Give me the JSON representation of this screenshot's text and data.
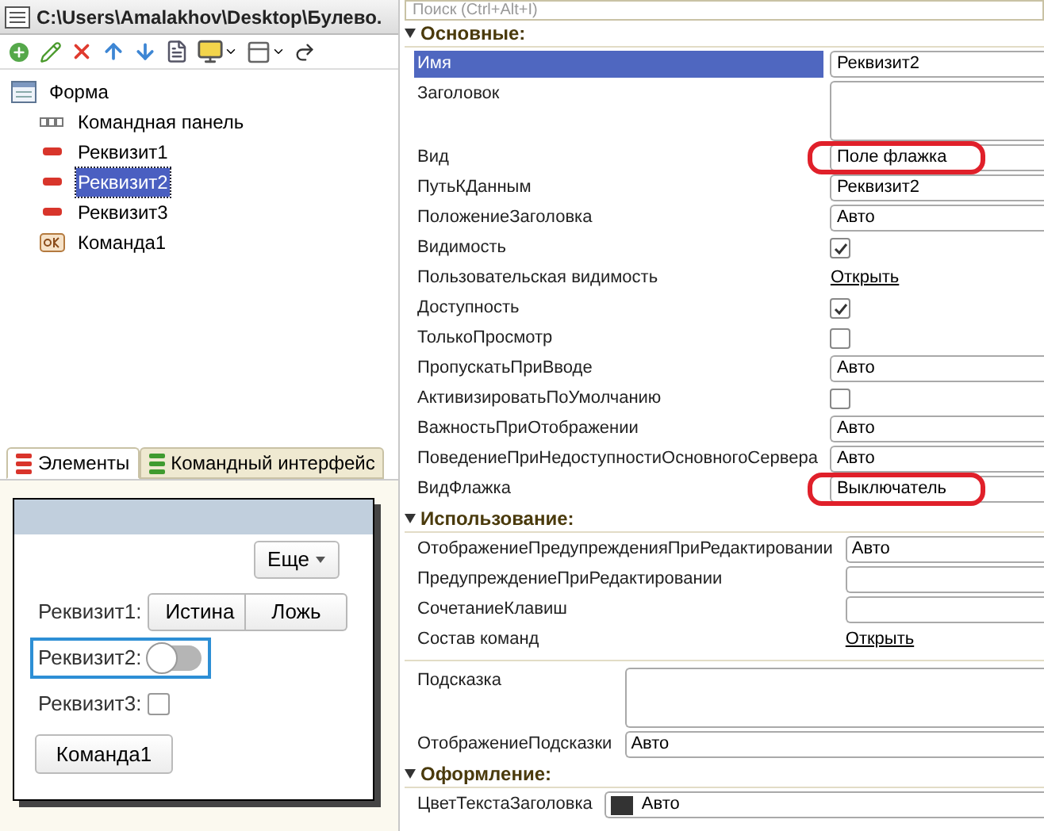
{
  "window": {
    "title": "C:\\Users\\Amalakhov\\Desktop\\Булево."
  },
  "tree": [
    {
      "label": "Форма",
      "kind": "form",
      "selected": false,
      "children": [
        {
          "label": "Командная панель",
          "kind": "command_bar",
          "selected": false
        },
        {
          "label": "Реквизит1",
          "kind": "attribute",
          "selected": false
        },
        {
          "label": "Реквизит2",
          "kind": "attribute",
          "selected": true
        },
        {
          "label": "Реквизит3",
          "kind": "attribute",
          "selected": false
        },
        {
          "label": "Команда1",
          "kind": "command",
          "selected": false
        }
      ]
    }
  ],
  "left_tabs": [
    {
      "label": "Элементы",
      "selected": true,
      "color": "#d9342b"
    },
    {
      "label": "Командный интерфейс",
      "selected": false,
      "color": "#3f9b2f"
    }
  ],
  "preview": {
    "more_button": "Еще",
    "fields": [
      {
        "kind": "toggle_buttons",
        "label": "Реквизит1:",
        "options": [
          "Истина",
          "Ложь"
        ],
        "focused": false
      },
      {
        "kind": "switch",
        "label": "Реквизит2:",
        "on": false,
        "focused": true
      },
      {
        "kind": "checkbox",
        "label": "Реквизит3:",
        "checked": false,
        "focused": false
      }
    ],
    "command_button": "Команда1"
  },
  "properties": {
    "search": {
      "placeholder": "Поиск (Ctrl+Alt+I)"
    },
    "sections": [
      {
        "title": "Основные:",
        "expanded": true,
        "groups": [
          [
            {
              "kind": "text",
              "label": "Имя",
              "value": "Реквизит2",
              "selected": true,
              "annotated": false
            },
            {
              "kind": "textarea",
              "label": "Заголовок",
              "selected": false,
              "annotated": false
            },
            {
              "kind": "text",
              "label": "Вид",
              "value": "Поле флажка",
              "selected": false,
              "annotated": true
            },
            {
              "kind": "text",
              "label": "ПутьКДанным",
              "value": "Реквизит2",
              "selected": false,
              "annotated": false
            },
            {
              "kind": "text",
              "label": "ПоложениеЗаголовка",
              "value": "Авто",
              "selected": false,
              "annotated": false
            },
            {
              "kind": "checkbox",
              "label": "Видимость",
              "checked": true,
              "selected": false,
              "annotated": false
            },
            {
              "kind": "link",
              "label": "Пользовательская видимость",
              "value": "Открыть",
              "selected": false,
              "annotated": false
            },
            {
              "kind": "checkbox",
              "label": "Доступность",
              "checked": true,
              "selected": false,
              "annotated": false
            },
            {
              "kind": "checkbox",
              "label": "ТолькоПросмотр",
              "checked": false,
              "selected": false,
              "annotated": false
            },
            {
              "kind": "text",
              "label": "ПропускатьПриВводе",
              "value": "Авто",
              "selected": false,
              "annotated": false
            },
            {
              "kind": "checkbox",
              "label": "АктивизироватьПоУмолчанию",
              "checked": false,
              "selected": false,
              "annotated": false
            },
            {
              "kind": "text",
              "label": "ВажностьПриОтображении",
              "value": "Авто",
              "selected": false,
              "annotated": false
            },
            {
              "kind": "text",
              "label": "ПоведениеПриНедоступностиОсновногоСервера",
              "value": "Авто",
              "selected": false,
              "annotated": false
            },
            {
              "kind": "text",
              "label": "ВидФлажка",
              "value": "Выключатель",
              "selected": false,
              "annotated": true
            }
          ]
        ]
      },
      {
        "title": "Использование:",
        "expanded": true,
        "groups": [
          [
            {
              "kind": "text",
              "label": "ОтображениеПредупрежденияПриРедактировании",
              "value": "Авто",
              "selected": false,
              "annotated": false
            },
            {
              "kind": "text",
              "label": "ПредупреждениеПриРедактировании",
              "selected": false,
              "annotated": false
            },
            {
              "kind": "text",
              "label": "СочетаниеКлавиш",
              "selected": false,
              "annotated": false
            },
            {
              "kind": "link",
              "label": "Состав команд",
              "value": "Открыть",
              "selected": false,
              "annotated": false
            }
          ],
          [
            {
              "kind": "textarea",
              "label": "Подсказка",
              "selected": false,
              "annotated": false
            },
            {
              "kind": "text",
              "label": "ОтображениеПодсказки",
              "value": "Авто",
              "selected": false,
              "annotated": false
            }
          ]
        ]
      },
      {
        "title": "Оформление:",
        "expanded": true,
        "groups": [
          [
            {
              "kind": "color",
              "label": "ЦветТекстаЗаголовка",
              "value": "Авто",
              "color": "#333333",
              "selected": false,
              "annotated": false
            }
          ]
        ]
      }
    ]
  }
}
